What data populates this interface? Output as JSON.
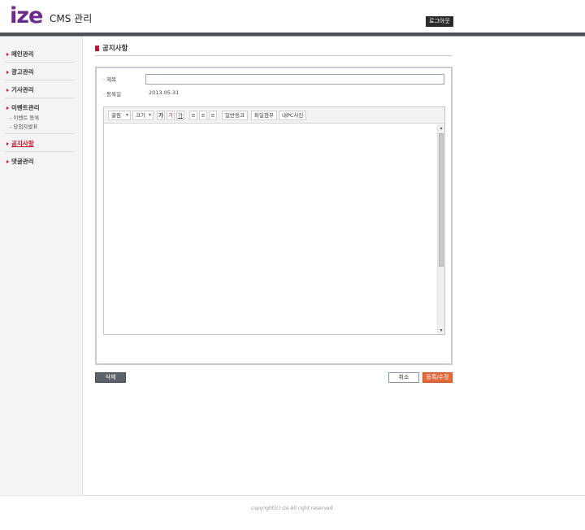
{
  "header": {
    "logo_text": "ize",
    "app_title": "CMS 관리",
    "logout_label": "로그아웃",
    "brand_color": "#6b2c8f"
  },
  "sidebar": {
    "items": [
      {
        "label": "메인관리"
      },
      {
        "label": "광고관리"
      },
      {
        "label": "기사관리"
      },
      {
        "label": "이벤트관리",
        "subitems": [
          "- 이벤트 등록",
          "- 당첨자발표"
        ]
      },
      {
        "label": "공지사항",
        "active": true
      },
      {
        "label": "댓글관리"
      }
    ],
    "accent_color": "#c8102e"
  },
  "main": {
    "section_title": "공지사항",
    "form": {
      "subject_label": "· 제목",
      "subject_value": "",
      "date_label": "· 등록일",
      "date_value": "2013.05.31"
    },
    "editor": {
      "toolbar": {
        "font_label": "굴림",
        "size_label": "크기",
        "bold_label": "가",
        "color_label": "가",
        "bg_label": "가",
        "link_label": "일반링크",
        "attach_label": "파일첨부",
        "photo_label": "내PC사진"
      },
      "align_icons": [
        "align-left-icon",
        "align-center-icon",
        "align-right-icon"
      ]
    },
    "buttons": {
      "delete_label": "삭제",
      "cancel_label": "취소",
      "submit_label": "등록/수정"
    }
  },
  "footer": {
    "copyright": "copyright(c) ize All right reserved."
  }
}
